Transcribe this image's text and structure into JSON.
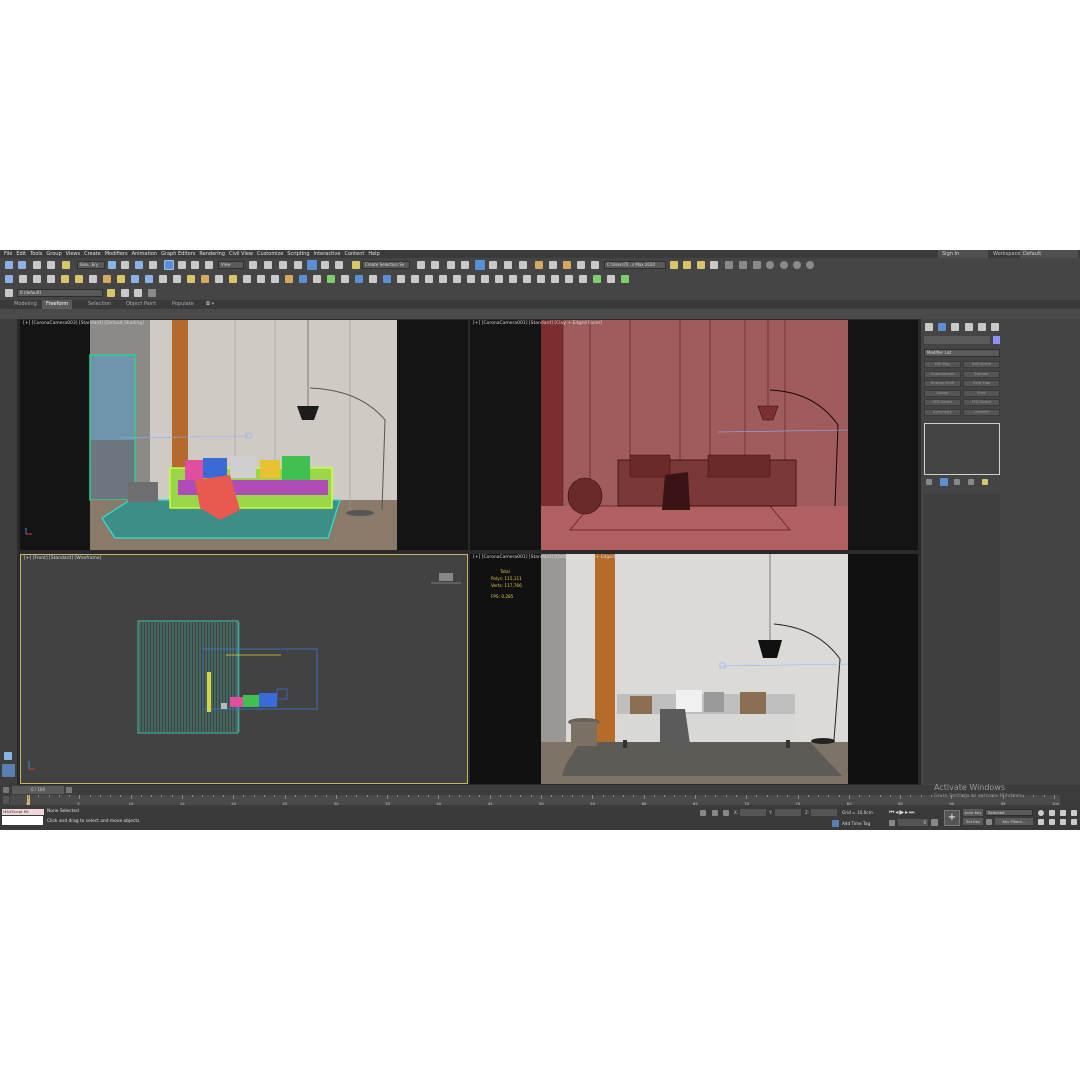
{
  "menu": [
    "File",
    "Edit",
    "Tools",
    "Group",
    "Views",
    "Create",
    "Modifiers",
    "Animation",
    "Graph Editors",
    "Rendering",
    "Civil View",
    "Customize",
    "Scripting",
    "Interactive",
    "Content",
    "Help"
  ],
  "account": {
    "sign_in": "Sign In",
    "workspace_label": "Workspaces:",
    "workspace_value": "Default"
  },
  "toolbar": {
    "selection_filter": "Geo...Ery",
    "reference_coord": "View",
    "named_selection": "Create Selection Se",
    "project_path": "C:\\Users\\Tr...s Max 2020"
  },
  "layer": {
    "layer_name": "0 (default)"
  },
  "ribbon": {
    "tabs": [
      "Modeling",
      "Freeform",
      "Selection",
      "Object Paint",
      "Populate"
    ],
    "active": "Freeform"
  },
  "viewports": {
    "top_left": {
      "label": "[+] [CoronaCamera003] [Standard] [Default Shading]"
    },
    "top_right": {
      "label": "[+] [CoronaCamera001] [Standard] [Clay + Edged Faces]"
    },
    "bottom_left": {
      "label": "[+] [Front] [Standard] [Wireframe]"
    },
    "bottom_right": {
      "label": "[+] [CoronaCamera001] [Standard] [Default Shading] + Edged Faces"
    },
    "stats": {
      "total_label": "Total",
      "polys_label": "Polys:",
      "polys_value": "115,111",
      "verts_label": "Verts:",
      "verts_value": "117,766",
      "fps_label": "FPS:",
      "fps_value": "0.285"
    }
  },
  "command_panel": {
    "modifier_list": "Modifier List",
    "buttons": [
      "Edit Poly",
      "Edit Spline",
      "TurboSmooth",
      "Extrude",
      "Unwrap UVW",
      "UVW Map",
      "Sweep",
      "Shell",
      "FFD Select",
      "FFD Select",
      "Symmetry",
      "Chamfer"
    ]
  },
  "timeline": {
    "frame_display": "0 / 100",
    "ticks": [
      "0",
      "5",
      "10",
      "15",
      "20",
      "25",
      "30",
      "35",
      "40",
      "45",
      "50",
      "55",
      "60",
      "65",
      "70",
      "75",
      "80",
      "85",
      "90",
      "95",
      "100"
    ]
  },
  "status": {
    "maxscript": "MAXScript Mi:",
    "selection_status": "None Selected",
    "prompt": "Click and drag to select and move objects",
    "x_label": "X:",
    "y_label": "Y:",
    "z_label": "Z:",
    "grid": "Grid = 10,0cm",
    "add_time_tag": "Add Time Tag",
    "auto_key": "Auto Key",
    "set_key": "Set Key",
    "key_mode": "Selected",
    "key_filters": "Key Filters...",
    "frame_value": "0"
  },
  "watermark": {
    "title": "Activate Windows",
    "sub": "Go to Settings to activate Windows."
  },
  "colors": {
    "accent_blue": "#5a8fd6",
    "viewport_active_border": "#c8b560",
    "app_bg": "#444444"
  }
}
